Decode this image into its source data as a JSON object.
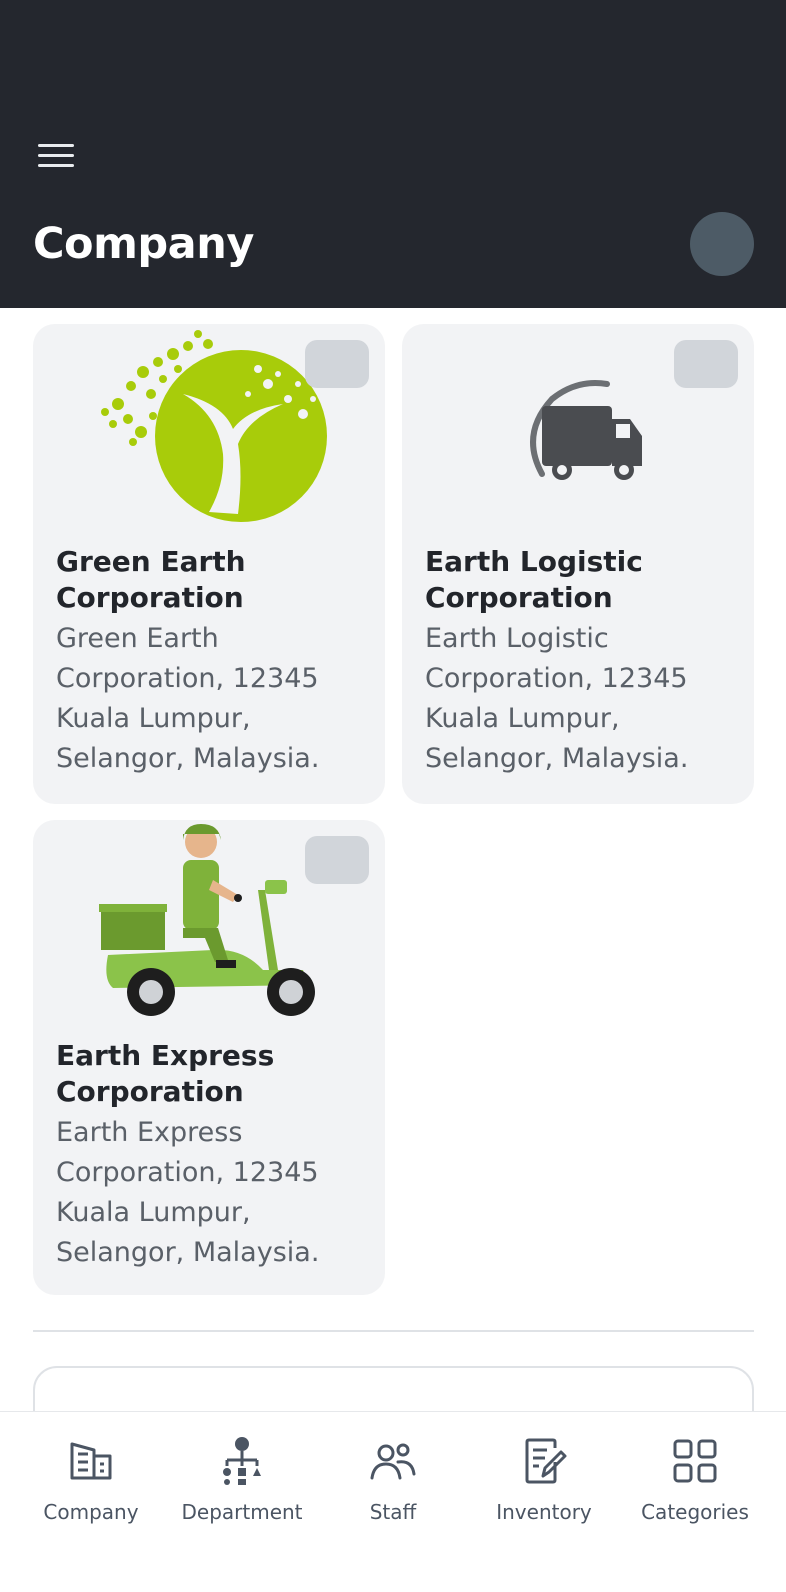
{
  "header": {
    "title": "Company",
    "menu_icon": "hamburger-menu-icon",
    "avatar_color": "#4d5b66",
    "background": "#24272e"
  },
  "companies": [
    {
      "name": "Green Earth Corporation",
      "address": "Green Earth Corporation, 12345 Kuala Lumpur, Selangor, Malaysia.",
      "logo": "green-tree-logo"
    },
    {
      "name": "Earth Logistic Corporation",
      "address": "Earth Logistic Corporation, 12345 Kuala Lumpur, Selangor, Malaysia.",
      "logo": "delivery-truck-logo"
    },
    {
      "name": "Earth Express Corporation",
      "address": "Earth Express Corporation, 12345 Kuala Lumpur, Selangor, Malaysia.",
      "logo": "scooter-courier-logo"
    }
  ],
  "bottom_nav": [
    {
      "label": "Company",
      "icon": "building-icon"
    },
    {
      "label": "Department",
      "icon": "org-chart-icon"
    },
    {
      "label": "Staff",
      "icon": "people-icon"
    },
    {
      "label": "Inventory",
      "icon": "document-edit-icon"
    },
    {
      "label": "Categories",
      "icon": "grid-icon"
    }
  ]
}
